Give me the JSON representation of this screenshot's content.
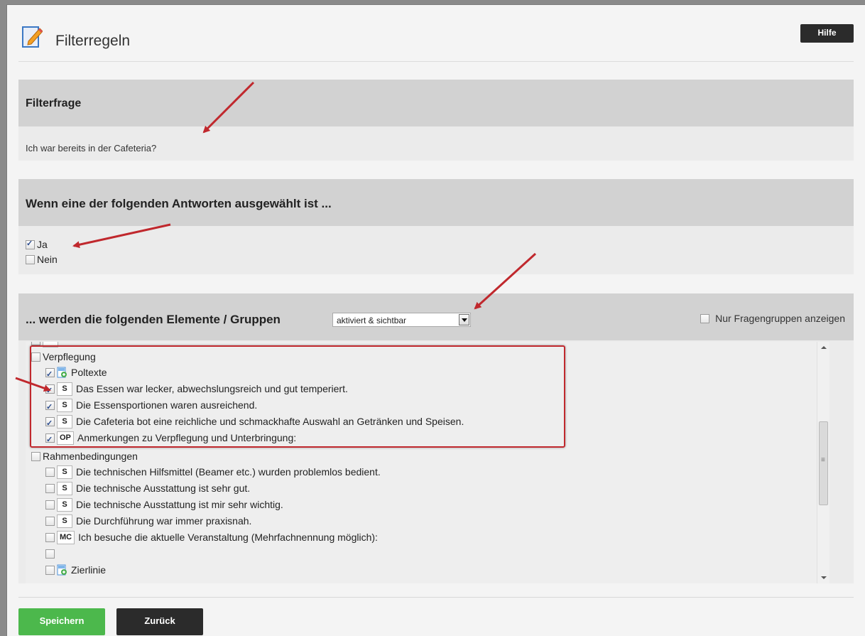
{
  "header": {
    "title": "Filterregeln",
    "help_label": "Hilfe"
  },
  "filter_question": {
    "heading": "Filterfrage",
    "text": "Ich war bereits in der Cafeteria?"
  },
  "answers_section": {
    "heading": "Wenn eine der folgenden Antworten ausgewählt ist ...",
    "answers": [
      {
        "label": "Ja",
        "checked": true
      },
      {
        "label": "Nein",
        "checked": false
      }
    ]
  },
  "elements_section": {
    "heading": "... werden die folgenden Elemente / Gruppen",
    "dropdown_value": "aktiviert & sichtbar",
    "only_groups_label": "Nur Fragengruppen anzeigen",
    "tree": {
      "group1": {
        "label": "Verpflegung",
        "items": [
          {
            "badge": "",
            "icon": "page-add-icon",
            "label": "Poltexte",
            "checked": true
          },
          {
            "badge": "S",
            "label": "Das Essen war lecker, abwechslungsreich und gut temperiert.",
            "checked": true
          },
          {
            "badge": "S",
            "label": "Die Essensportionen waren ausreichend.",
            "checked": true
          },
          {
            "badge": "S",
            "label": "Die Cafeteria bot eine reichliche und schmackhafte Auswahl an Getränken und Speisen.",
            "checked": true
          },
          {
            "badge": "OP",
            "label": "Anmerkungen zu Verpflegung und Unterbringung:",
            "checked": true
          }
        ]
      },
      "group2": {
        "label": "Rahmenbedingungen",
        "items": [
          {
            "badge": "S",
            "label": "Die technischen Hilfsmittel (Beamer etc.) wurden problemlos bedient.",
            "checked": false
          },
          {
            "badge": "S",
            "label": "Die technische Ausstattung ist sehr gut.",
            "checked": false
          },
          {
            "badge": "S",
            "label": "Die technische Ausstattung ist mir sehr wichtig.",
            "checked": false
          },
          {
            "badge": "S",
            "label": "Die Durchführung war immer praxisnah.",
            "checked": false
          },
          {
            "badge": "MC",
            "label": "Ich besuche die aktuelle Veranstaltung (Mehrfachnennung möglich):",
            "checked": false
          },
          {
            "badge": "",
            "label": "",
            "checked": false
          },
          {
            "badge": "",
            "icon": "page-add-icon",
            "label": "Zierlinie",
            "checked": false
          }
        ]
      }
    }
  },
  "footer": {
    "save_label": "Speichern",
    "back_label": "Zurück"
  },
  "colors": {
    "save": "#4cb84c",
    "dark": "#2b2b2b",
    "annotation_red": "#c0282d"
  }
}
